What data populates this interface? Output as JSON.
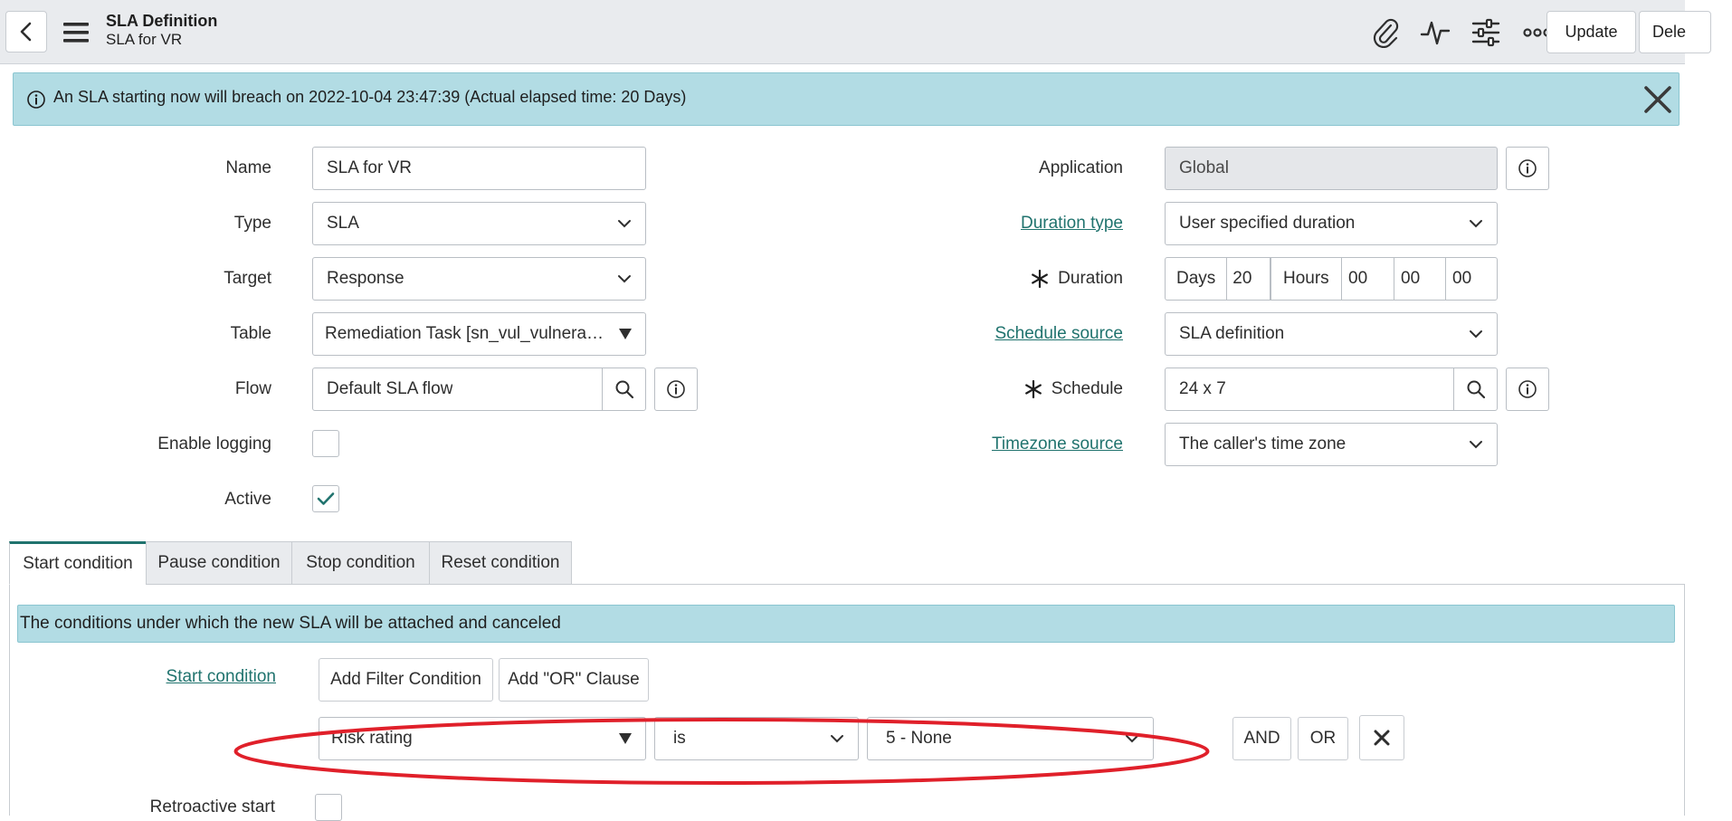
{
  "header": {
    "title": "SLA Definition",
    "subtitle": "SLA for VR",
    "update_label": "Update",
    "delete_label": "Dele",
    "tools": [
      "paperclip-icon",
      "activity-icon",
      "sliders-icon",
      "more-icon"
    ]
  },
  "banner": {
    "message": "An SLA starting now will breach on 2022-10-04 23:47:39 (Actual elapsed time: 20 Days)"
  },
  "form": {
    "name": {
      "label": "Name",
      "value": "SLA for VR"
    },
    "type": {
      "label": "Type",
      "value": "SLA"
    },
    "target": {
      "label": "Target",
      "value": "Response"
    },
    "table": {
      "label": "Table",
      "value": "Remediation Task [sn_vul_vulnerab…"
    },
    "flow": {
      "label": "Flow",
      "value": "Default SLA flow"
    },
    "enable_logging": {
      "label": "Enable logging",
      "checked": false
    },
    "active": {
      "label": "Active",
      "checked": true
    },
    "application": {
      "label": "Application",
      "value": "Global"
    },
    "duration_type": {
      "label": "Duration type",
      "value": "User specified duration"
    },
    "duration": {
      "label": "Duration",
      "days_label": "Days",
      "days_value": "20",
      "hours_label": "Hours",
      "hours_value": "00",
      "minutes_value": "00",
      "seconds_value": "00"
    },
    "schedule_source": {
      "label": "Schedule source",
      "value": "SLA definition"
    },
    "schedule": {
      "label": "Schedule",
      "value": "24 x 7"
    },
    "timezone_source": {
      "label": "Timezone source",
      "value": "The caller's time zone"
    }
  },
  "tabs": [
    {
      "label": "Start condition",
      "active": true
    },
    {
      "label": "Pause condition",
      "active": false
    },
    {
      "label": "Stop condition",
      "active": false
    },
    {
      "label": "Reset condition",
      "active": false
    }
  ],
  "condition": {
    "banner": "The conditions under which the new SLA will be attached and canceled",
    "label": "Start condition",
    "add_filter_label": "Add Filter Condition",
    "add_or_label": "Add \"OR\" Clause",
    "field_value": "Risk rating",
    "operator_value": "is",
    "value_value": "5 - None",
    "and_label": "AND",
    "or_label": "OR"
  },
  "retroactive": {
    "label": "Retroactive start",
    "checked": false
  },
  "colors": {
    "header_bg": "#e9ebee",
    "info_banner": "#b2dce4",
    "link": "#20736e",
    "highlight": "#e0202a"
  }
}
